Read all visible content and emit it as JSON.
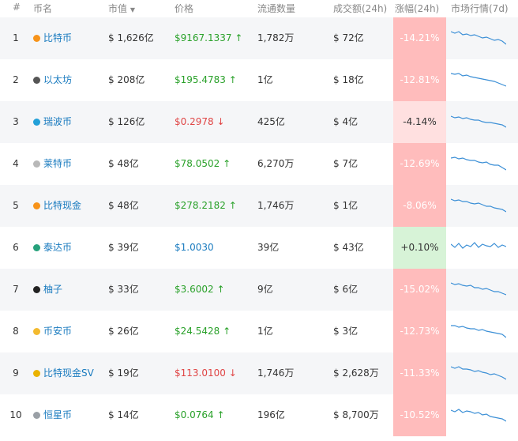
{
  "header": {
    "rank": "#",
    "name": "币名",
    "mcap": "市值",
    "price": "价格",
    "supply": "流通数量",
    "volume": "成交额(24h)",
    "change": "涨幅(24h)",
    "trend": "市场行情(7d)"
  },
  "colors": {
    "accent": "#1a7bbf",
    "up": "#2aa12a",
    "down": "#e04545",
    "neg_strong": "#ffbcbc",
    "neg_light": "#ffe0e0",
    "pos": "#d7f3d7"
  },
  "rows": [
    {
      "rank": "1",
      "name": "比特币",
      "icon": "bitcoin-icon",
      "icon_color": "#f7931a",
      "mcap": "$ 1,626亿",
      "price": "$9167.1337",
      "dir": "up",
      "arrow": "↑",
      "supply": "1,782万",
      "volume": "$ 72亿",
      "change": "-14.21%",
      "chg_level": "strong"
    },
    {
      "rank": "2",
      "name": "以太坊",
      "icon": "ethereum-icon",
      "icon_color": "#555555",
      "mcap": "$ 208亿",
      "price": "$195.4783",
      "dir": "up",
      "arrow": "↑",
      "supply": "1亿",
      "volume": "$ 18亿",
      "change": "-12.81%",
      "chg_level": "strong"
    },
    {
      "rank": "3",
      "name": "瑞波币",
      "icon": "ripple-icon",
      "icon_color": "#23a0d8",
      "mcap": "$ 126亿",
      "price": "$0.2978",
      "dir": "down",
      "arrow": "↓",
      "supply": "425亿",
      "volume": "$ 4亿",
      "change": "-4.14%",
      "chg_level": "light"
    },
    {
      "rank": "4",
      "name": "莱特币",
      "icon": "litecoin-icon",
      "icon_color": "#b8b8b8",
      "mcap": "$ 48亿",
      "price": "$78.0502",
      "dir": "up",
      "arrow": "↑",
      "supply": "6,270万",
      "volume": "$ 7亿",
      "change": "-12.69%",
      "chg_level": "strong"
    },
    {
      "rank": "5",
      "name": "比特现金",
      "icon": "bitcoin-cash-icon",
      "icon_color": "#f7931a",
      "mcap": "$ 48亿",
      "price": "$278.2182",
      "dir": "up",
      "arrow": "↑",
      "supply": "1,746万",
      "volume": "$ 1亿",
      "change": "-8.06%",
      "chg_level": "strong"
    },
    {
      "rank": "6",
      "name": "泰达币",
      "icon": "tether-icon",
      "icon_color": "#26a17b",
      "mcap": "$ 39亿",
      "price": "$1.0030",
      "dir": "flat",
      "arrow": "",
      "supply": "39亿",
      "volume": "$ 43亿",
      "change": "+0.10%",
      "chg_level": "pos"
    },
    {
      "rank": "7",
      "name": "柚子",
      "icon": "eos-icon",
      "icon_color": "#222222",
      "mcap": "$ 33亿",
      "price": "$3.6002",
      "dir": "up",
      "arrow": "↑",
      "supply": "9亿",
      "volume": "$ 6亿",
      "change": "-15.02%",
      "chg_level": "strong"
    },
    {
      "rank": "8",
      "name": "币安币",
      "icon": "binance-icon",
      "icon_color": "#f3ba2f",
      "mcap": "$ 26亿",
      "price": "$24.5428",
      "dir": "up",
      "arrow": "↑",
      "supply": "1亿",
      "volume": "$ 3亿",
      "change": "-12.73%",
      "chg_level": "strong"
    },
    {
      "rank": "9",
      "name": "比特现金SV",
      "icon": "bitcoin-sv-icon",
      "icon_color": "#eab300",
      "mcap": "$ 19亿",
      "price": "$113.0100",
      "dir": "down",
      "arrow": "↓",
      "supply": "1,746万",
      "volume": "$ 2,628万",
      "change": "-11.33%",
      "chg_level": "strong"
    },
    {
      "rank": "10",
      "name": "恒星币",
      "icon": "stellar-icon",
      "icon_color": "#9aa0a6",
      "mcap": "$ 14亿",
      "price": "$0.0764",
      "dir": "up",
      "arrow": "↑",
      "supply": "196亿",
      "volume": "$ 8,700万",
      "change": "-10.52%",
      "chg_level": "strong"
    }
  ]
}
